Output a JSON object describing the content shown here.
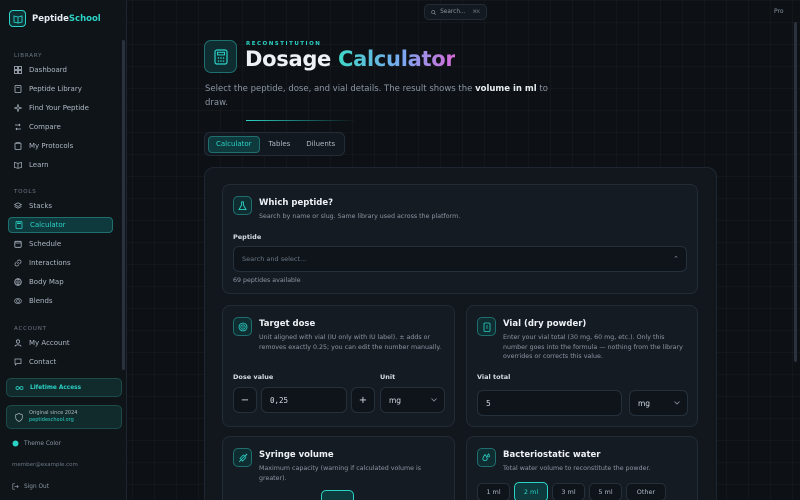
{
  "brand": {
    "name_part1": "Peptide",
    "name_part2": "School"
  },
  "sidebar": {
    "library_heading": "LIBRARY",
    "library_items": [
      {
        "label": "Dashboard",
        "icon": "dashboard-icon"
      },
      {
        "label": "Peptide Library",
        "icon": "book-icon"
      },
      {
        "label": "Find Your Peptide",
        "icon": "sparkle-icon"
      },
      {
        "label": "Compare",
        "icon": "compare-icon"
      },
      {
        "label": "My Protocols",
        "icon": "clipboard-icon"
      },
      {
        "label": "Learn",
        "icon": "open-book-icon"
      }
    ],
    "tools_heading": "TOOLS",
    "tools_items": [
      {
        "label": "Stacks",
        "icon": "layers-icon"
      },
      {
        "label": "Calculator",
        "icon": "calculator-icon",
        "active": true
      },
      {
        "label": "Schedule",
        "icon": "calendar-icon"
      },
      {
        "label": "Interactions",
        "icon": "link-icon"
      },
      {
        "label": "Body Map",
        "icon": "body-icon"
      },
      {
        "label": "Blends",
        "icon": "blend-icon"
      }
    ],
    "account_heading": "ACCOUNT",
    "account_items": [
      {
        "label": "My Account",
        "icon": "user-icon"
      },
      {
        "label": "Contact",
        "icon": "chat-icon"
      }
    ],
    "lifetime_label": "Lifetime Access",
    "original_label": "Original since 2024",
    "original_site": "peptideschool.org",
    "theme_label": "Theme Color",
    "email": "member@example.com",
    "signout_label": "Sign Out"
  },
  "topbar": {
    "search_placeholder": "Search...",
    "search_kbd": "⌘K",
    "plan": "Pro"
  },
  "header": {
    "eyebrow": "RECONSTITUTION",
    "title_part1": "Dosage",
    "title_part2": "Calculator",
    "description_pre": "Select the peptide, dose, and vial details. The result shows the",
    "description_bold": "volume in ml",
    "description_post": "to draw."
  },
  "tabs": [
    {
      "label": "Calculator",
      "active": true
    },
    {
      "label": "Tables"
    },
    {
      "label": "Diluents"
    }
  ],
  "peptide_card": {
    "title": "Which peptide?",
    "subtitle": "Search by name or slug. Same library used across the platform.",
    "field_label": "Peptide",
    "placeholder": "Search and select...",
    "count_text": "69 peptides available"
  },
  "dose_card": {
    "title": "Target dose",
    "subtitle": "Unit aligned with vial (IU only with IU label). ± adds or removes exactly 0.25; you can edit the number manually.",
    "dose_label": "Dose value",
    "dose_value": "0,25",
    "minus": "−",
    "plus": "+",
    "unit_label": "Unit",
    "unit_value": "mg"
  },
  "vial_card": {
    "title": "Vial (dry powder)",
    "subtitle": "Enter your vial total (30 mg, 60 mg, etc.). Only this number goes into the formula — nothing from the library overrides or corrects this value.",
    "total_label": "Vial total",
    "total_value": "5",
    "unit_value": "mg"
  },
  "syringe_card": {
    "title": "Syringe volume",
    "subtitle": "Maximum capacity (warning if calculated volume is greater)."
  },
  "water_card": {
    "title": "Bacteriostatic water",
    "subtitle": "Total water volume to reconstitute the powder.",
    "options": [
      "1 ml",
      "2 ml",
      "3 ml",
      "5 ml",
      "Other"
    ],
    "selected": "2 ml"
  },
  "colors": {
    "accent": "#2bd3c6",
    "background": "#0d1116",
    "card": "#151b23"
  }
}
